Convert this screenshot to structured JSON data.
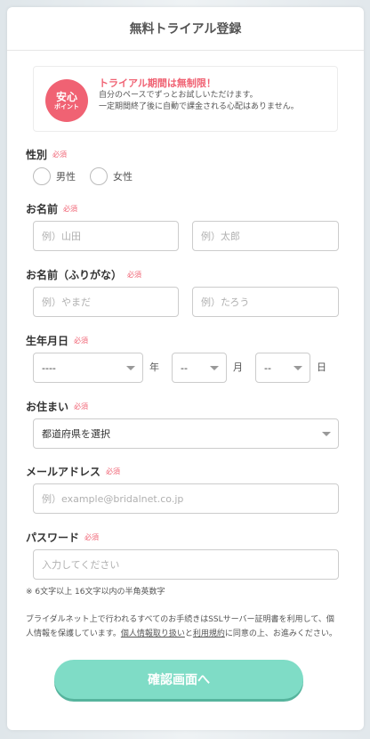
{
  "header": {
    "title": "無料トライアル登録"
  },
  "notice": {
    "badge_main": "安心",
    "badge_sub": "ポイント",
    "title": "トライアル期間は無制限！",
    "line1": "自分のペースでずっとお試しいただけます。",
    "line2": "一定期間終了後に自動で課金される心配はありません。"
  },
  "required_label": "必須",
  "gender": {
    "label": "性別",
    "options": [
      "男性",
      "女性"
    ]
  },
  "name": {
    "label": "お名前",
    "last_placeholder": "例）山田",
    "first_placeholder": "例）太郎"
  },
  "kana": {
    "label": "お名前（ふりがな）",
    "last_placeholder": "例）やまだ",
    "first_placeholder": "例）たろう"
  },
  "birth": {
    "label": "生年月日",
    "year_value": "----",
    "year_unit": "年",
    "month_value": "--",
    "month_unit": "月",
    "day_value": "--",
    "day_unit": "日"
  },
  "address": {
    "label": "お住まい",
    "value": "都道府県を選択"
  },
  "email": {
    "label": "メールアドレス",
    "placeholder": "例）example@bridalnet.co.jp"
  },
  "password": {
    "label": "パスワード",
    "placeholder": "入力してください",
    "hint": "※ 6文字以上 16文字以内の半角英数字"
  },
  "privacy": {
    "text1": "ブライダルネット上で行われるすべてのお手続きはSSLサーバー証明書を利用して、個人情報を保護しています。",
    "link1": "個人情報取り扱い",
    "text2": "と",
    "link2": "利用規約",
    "text3": "に同意の上、お進みください。"
  },
  "submit_label": "確認画面へ",
  "colors": {
    "accent_pink": "#f06273",
    "button_mint": "#7fdcc6"
  }
}
